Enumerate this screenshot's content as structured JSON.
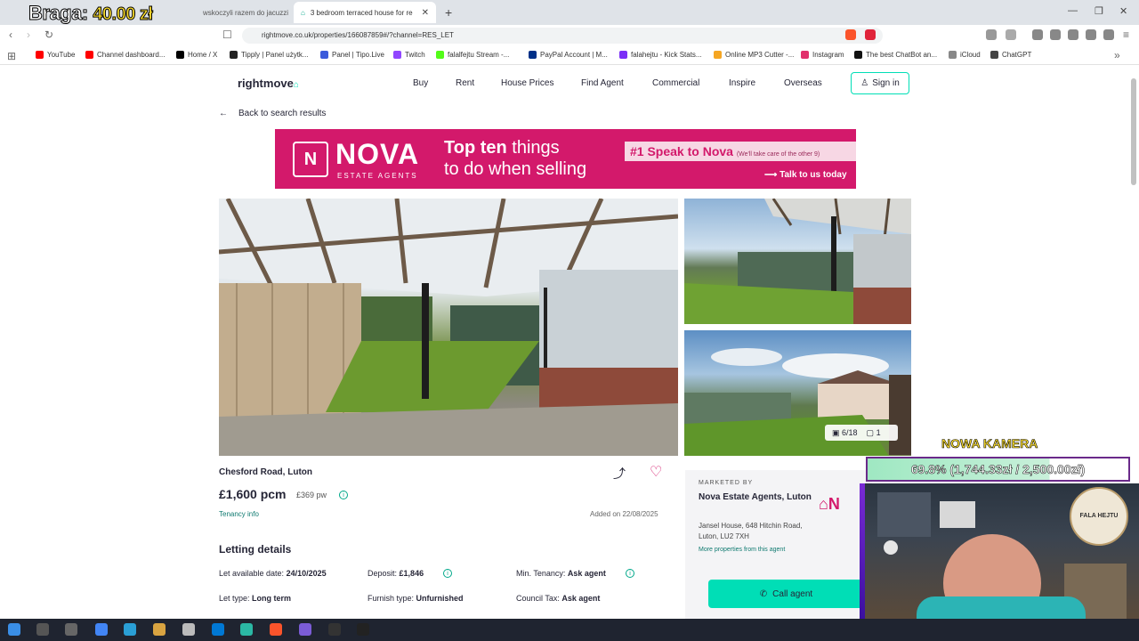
{
  "browser": {
    "tabs": [
      {
        "label": "wskoczyli razem do jacuzzi"
      },
      {
        "label": "3 bedroom terraced house for re"
      }
    ],
    "url": "rightmove.co.uk/properties/166087859#/?channel=RES_LET",
    "bookmarks": [
      {
        "label": "YouTube",
        "color": "#ff0000"
      },
      {
        "label": "Channel dashboard...",
        "color": "#ff0000"
      },
      {
        "label": "Home / X",
        "color": "#000000"
      },
      {
        "label": "Tipply | Panel użytk...",
        "color": "#222222"
      },
      {
        "label": "Panel | Tipo.Live",
        "color": "#3b5bdb"
      },
      {
        "label": "Twitch",
        "color": "#9146ff"
      },
      {
        "label": "falalfejtu Stream -...",
        "color": "#53fc18"
      },
      {
        "label": "PayPal Account | M...",
        "color": "#003087"
      },
      {
        "label": "falahejtu - Kick Stats...",
        "color": "#7b2ff7"
      },
      {
        "label": "Online MP3 Cutter -...",
        "color": "#f5a623"
      },
      {
        "label": "Instagram",
        "color": "#e1306c"
      },
      {
        "label": "The best ChatBot an...",
        "color": "#111111"
      },
      {
        "label": "iCloud",
        "color": "#888888"
      },
      {
        "label": "ChatGPT",
        "color": "#444444"
      }
    ]
  },
  "overlay": {
    "braga_label": "Braga:",
    "braga_amount": "40.00 zł",
    "nowa_kamera": "NOWA KAMERA",
    "goal_text": "69.8% (1,744.33zł / 2,500.00zł)",
    "goal_progress": 0.698,
    "fala_label": "FALA HEJTU"
  },
  "site": {
    "logo": "rightmove",
    "nav": [
      "Buy",
      "Rent",
      "House Prices",
      "Find Agent",
      "Commercial",
      "Inspire",
      "Overseas"
    ],
    "sign_in": "Sign in",
    "back": "Back to search results"
  },
  "ad": {
    "brand": "NOVA",
    "brand_sub": "ESTATE AGENTS",
    "headline_bold": "Top ten",
    "headline_rest": " things",
    "headline_line2": "to do when selling",
    "speak": "#1 Speak to Nova",
    "speak_small": "(We'll take care of the other 9)",
    "cta": "Talk to us today"
  },
  "gallery": {
    "counter": "6/18",
    "floorplans": "1"
  },
  "property": {
    "address": "Chesford Road, Luton",
    "price": "£1,600 pcm",
    "price_pw": "£369 pw",
    "tenancy_info": "Tenancy info",
    "added": "Added on 22/08/2025"
  },
  "letting": {
    "title": "Letting details",
    "rows": [
      {
        "label": "Let available date:",
        "value": "24/10/2025"
      },
      {
        "label": "Deposit:",
        "value": "£1,846"
      },
      {
        "label": "Min. Tenancy:",
        "value": "Ask agent"
      },
      {
        "label": "Let type:",
        "value": "Long term"
      },
      {
        "label": "Furnish type:",
        "value": "Unfurnished"
      },
      {
        "label": "Council Tax:",
        "value": "Ask agent"
      }
    ]
  },
  "agent": {
    "marketed_by": "MARKETED BY",
    "name": "Nova Estate Agents, Luton",
    "address": "Jansel House, 648 Hitchin Road, Luton, LU2 7XH",
    "more": "More properties from this agent",
    "call": "Call agent"
  },
  "colors": {
    "brand_accent": "#00deb6",
    "nova_pink": "#d3196b"
  }
}
